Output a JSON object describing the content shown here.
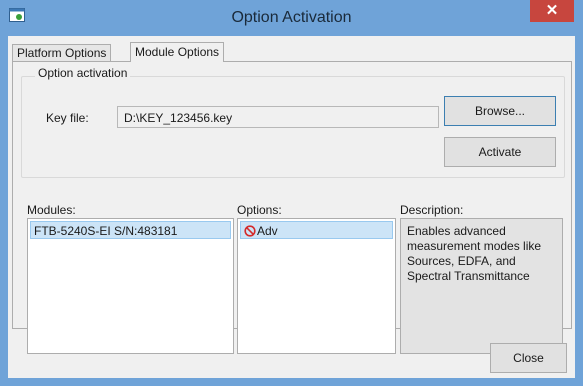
{
  "window": {
    "title": "Option Activation",
    "close_glyph": "✕"
  },
  "tabs": [
    {
      "label": "Platform Options",
      "active": false
    },
    {
      "label": "Module Options",
      "active": true
    }
  ],
  "activation": {
    "group_label": "Option activation",
    "key_file_label": "Key file:",
    "key_file_value": "D:\\KEY_123456.key",
    "browse_label": "Browse...",
    "activate_label": "Activate"
  },
  "modules": {
    "label": "Modules:",
    "items": [
      "FTB-5240S-EI S/N:483181"
    ]
  },
  "options": {
    "label": "Options:",
    "items": [
      {
        "name": "Adv",
        "status_icon": "not-activated-icon"
      }
    ]
  },
  "description": {
    "label": "Description:",
    "text": "Enables advanced measurement modes like Sources, EDFA, and Spectral Transmittance"
  },
  "footer": {
    "close_label": "Close"
  },
  "colors": {
    "titlebar": "#6fa3d8",
    "close_button": "#c7463e",
    "selection": "#cce4f7"
  }
}
